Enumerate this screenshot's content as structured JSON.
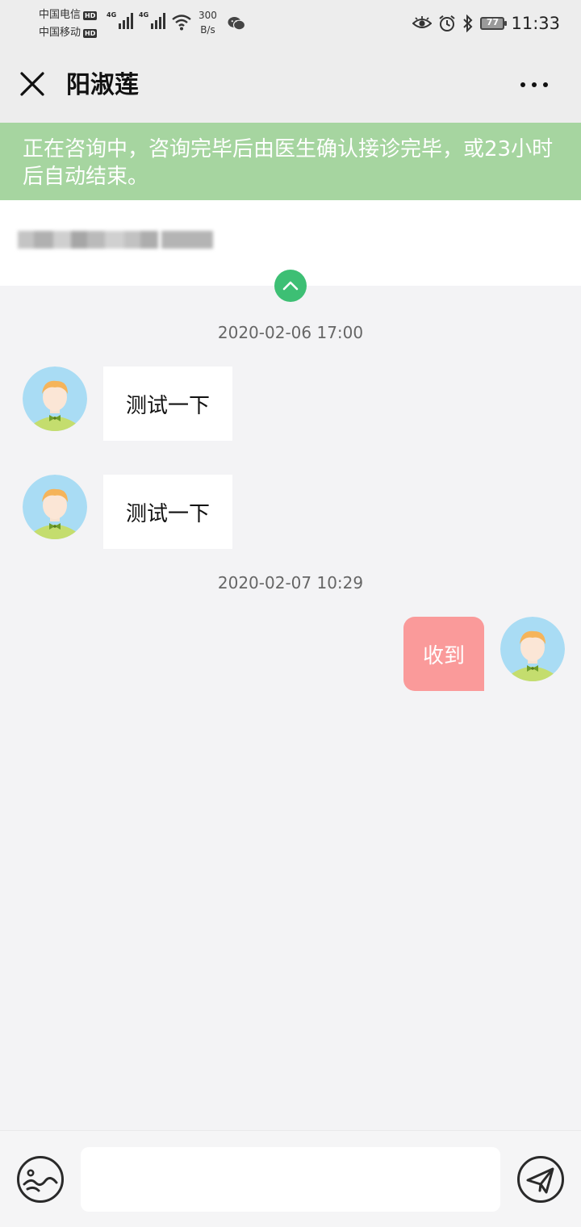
{
  "status_bar": {
    "carrier_1": "中国电信",
    "carrier_2": "中国移动",
    "hd_label": "HD",
    "network_type": "4G",
    "speed_value": "300",
    "speed_unit": "B/s",
    "battery": "77",
    "time": "11:33"
  },
  "header": {
    "title": "阳淑莲",
    "close_icon": "close-icon",
    "more_icon": "more-icon"
  },
  "notice": {
    "text": "正在咨询中，咨询完毕后由医生确认接诊完毕，或23小时后自动结束。",
    "background": "#a6d5a0"
  },
  "messages": [
    {
      "timestamp": "2020-02-06 17:00"
    },
    {
      "side": "left",
      "text": "测试一下"
    },
    {
      "side": "left",
      "text": "测试一下"
    },
    {
      "timestamp": "2020-02-07 10:29"
    },
    {
      "side": "right",
      "text": "收到"
    }
  ],
  "composer": {
    "input_value": "",
    "image_icon": "image-icon",
    "send_icon": "send-icon"
  },
  "colors": {
    "accent_green": "#3dbf74",
    "outgoing_bubble": "#fa9a9a"
  }
}
